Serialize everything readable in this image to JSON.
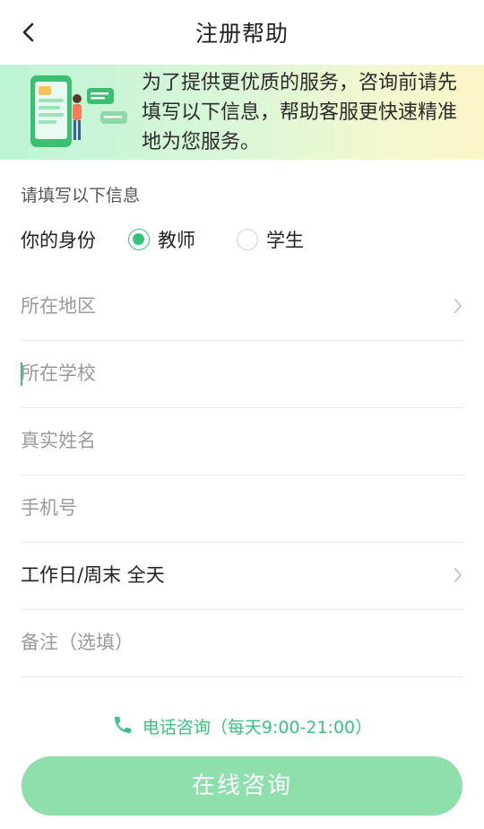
{
  "header": {
    "title": "注册帮助"
  },
  "banner": {
    "text": "为了提供更优质的服务，咨询前请先填写以下信息，帮助客服更快速精准地为您服务。"
  },
  "form": {
    "section_title": "请填写以下信息",
    "identity": {
      "label": "你的身份",
      "options": [
        {
          "label": "教师",
          "selected": true
        },
        {
          "label": "学生",
          "selected": false
        }
      ]
    },
    "region": {
      "placeholder": "所在地区"
    },
    "school": {
      "placeholder": "所在学校"
    },
    "name": {
      "placeholder": "真实姓名"
    },
    "phone": {
      "placeholder": "手机号"
    },
    "time": {
      "value": "工作日/周末 全天"
    },
    "remark": {
      "placeholder": "备注（选填）"
    }
  },
  "phone_consult": {
    "label": "电话咨询（每天9:00-21:00）"
  },
  "online_consult": {
    "label": "在线咨询"
  },
  "colors": {
    "accent": "#36c47a",
    "button": "#8edfab",
    "placeholder": "#9a9a9a"
  }
}
